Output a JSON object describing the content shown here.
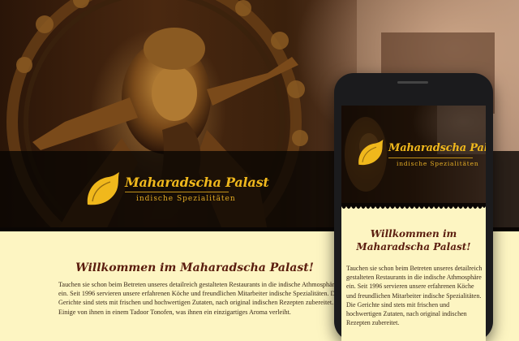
{
  "colors": {
    "gold": "#f0b81c",
    "cream": "#fdf5c2",
    "heading": "#5a1c0e",
    "band": "#080503"
  },
  "desktop": {
    "logo": {
      "title": "Maharadscha Palast",
      "subtitle": "indische Spezialitäten",
      "icon": "flame-leaf-icon"
    },
    "heading": "Willkommen im Maharadscha Palast!",
    "intro": "Tauchen sie schon beim Betreten unseres detailreich gestalteten Restaurants in die indische Athmosphäre ein. Seit 1996 servieren unsere erfahrenen Köche und freundlichen Mitarbeiter indische Spezialitäten. Die Gerichte sind stets mit frischen und hochwertigen Zutaten, nach original indischen Rezepten zubereitet. Einige von ihnen in einem Tadoor Tonofen, was ihnen ein einzigartiges Aroma verleiht."
  },
  "phone": {
    "logo": {
      "title": "Maharadscha Palast",
      "subtitle": "indische Spezialitäten",
      "icon": "flame-leaf-icon"
    },
    "heading": "Willkommen im Maharadscha Palast!",
    "intro": "Tauchen sie schon beim Betreten unseres detailreich gestalteten Restaurants in die indische Athmosphäre ein. Seit 1996 servieren unsere erfahrenen Köche und freundlichen Mitarbeiter indische Spezialitäten. Die Gerichte sind stets mit frischen und hochwertigen Zutaten, nach original indischen Rezepten zubereitet."
  }
}
